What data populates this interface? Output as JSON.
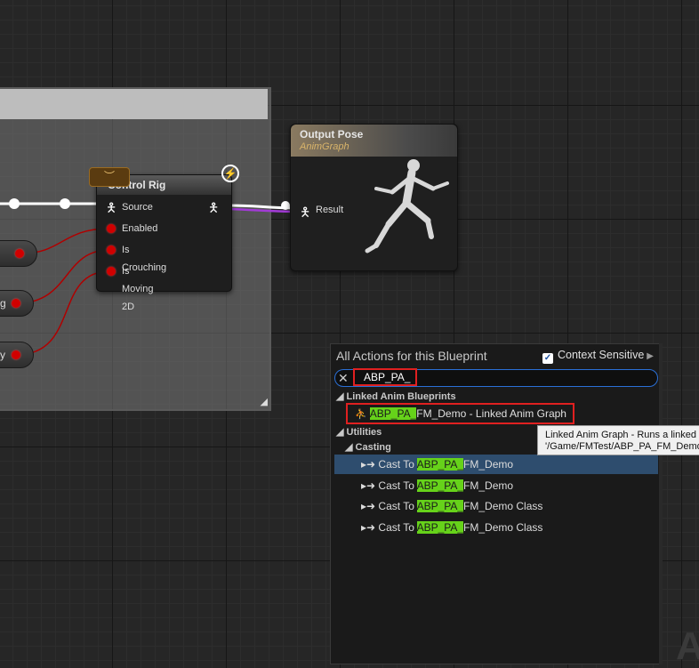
{
  "graph": {
    "control_rig": {
      "title": "Control Rig",
      "pins": [
        "Source",
        "Enabled",
        "Is Crouching",
        "Is Moving 2D"
      ]
    },
    "partial_pills": [
      "g",
      "y"
    ],
    "output_pose": {
      "title": "Output Pose",
      "subtitle": "AnimGraph",
      "pin": "Result"
    },
    "watermark": "A"
  },
  "menu": {
    "title": "All Actions for this Blueprint",
    "context_sensitive": "Context Sensitive",
    "search_value": "ABP_PA_",
    "categories": {
      "linked": "Linked Anim Blueprints",
      "utilities": "Utilities",
      "casting": "Casting"
    },
    "linked_item": {
      "highlight": "ABP_PA_",
      "rest": "FM_Demo - Linked Anim Graph"
    },
    "cast_items": [
      {
        "prefix": "Cast To ",
        "highlight": "ABP_PA_",
        "rest": "FM_Demo"
      },
      {
        "prefix": "Cast To ",
        "highlight": "ABP_PA_",
        "rest": "FM_Demo"
      },
      {
        "prefix": "Cast To ",
        "highlight": "ABP_PA_",
        "rest": "FM_Demo Class"
      },
      {
        "prefix": "Cast To ",
        "highlight": "ABP_PA_",
        "rest": "FM_Demo Class"
      }
    ]
  },
  "tooltip": {
    "line1": "Linked Anim Graph - Runs a linked",
    "line2": "'/Game/FMTest/ABP_PA_FM_Demo"
  },
  "colors": {
    "highlight": "#66d21a",
    "annotation_red": "#e02020",
    "wire_exec": "#ffffff",
    "wire_pose": "#a23bd6",
    "wire_bool": "#b00000",
    "selected_row": "#2e4d6e"
  }
}
